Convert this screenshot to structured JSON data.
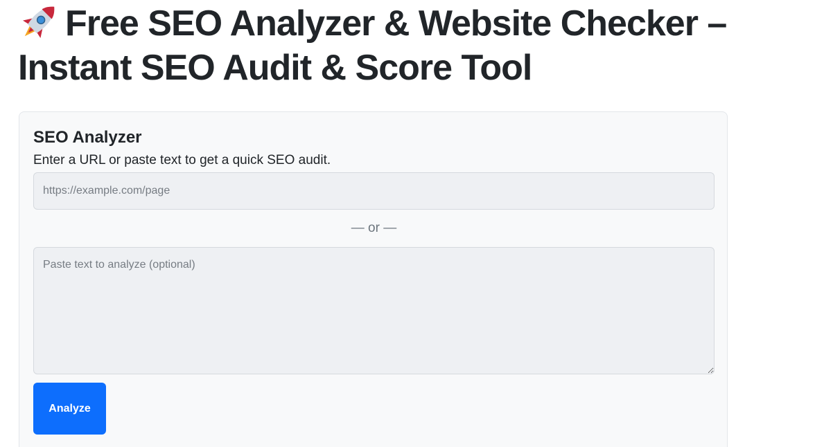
{
  "page": {
    "title": "Free SEO Analyzer & Website Checker – Instant SEO Audit & Score Tool",
    "title_icon": "rocket-icon"
  },
  "analyzer": {
    "heading": "SEO Analyzer",
    "description": "Enter a URL or paste text to get a quick SEO audit.",
    "url_input": {
      "value": "",
      "placeholder": "https://example.com/page"
    },
    "divider_text": "— or —",
    "text_input": {
      "value": "",
      "placeholder": "Paste text to analyze (optional)"
    },
    "analyze_label": "Analyze"
  },
  "colors": {
    "primary_button": "#0d6efd",
    "card_background": "#f8f9fa",
    "input_background": "#eef0f3",
    "text": "#212529",
    "muted_text": "#6c757d"
  }
}
